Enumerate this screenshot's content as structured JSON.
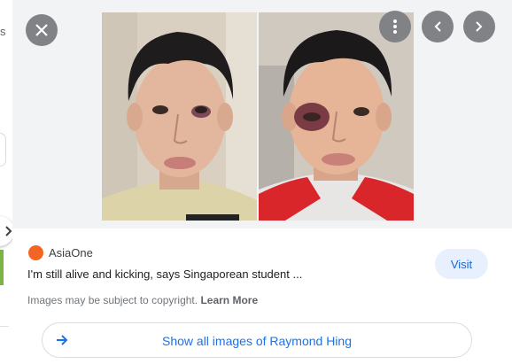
{
  "viewer": {
    "close_icon": "close-icon",
    "more_icon": "more-vert-icon",
    "prev_icon": "chevron-left-icon",
    "next_icon": "chevron-right-icon"
  },
  "left_panel": {
    "fragment_text": "s"
  },
  "source": {
    "name": "AsiaOne",
    "logo_text": "ASIA ONE",
    "logo_color": "#f26522"
  },
  "result": {
    "caption": "I'm still alive and kicking, says Singaporean student ...",
    "visit_label": "Visit"
  },
  "copyright": {
    "text": "Images may be subject to copyright.",
    "link": "Learn More"
  },
  "show_all": {
    "label": "Show all images of Raymond Hing"
  },
  "colors": {
    "accent": "#1a73e8",
    "visit_bg": "#e8f0fe",
    "viewer_bg": "#f1f3f4"
  }
}
